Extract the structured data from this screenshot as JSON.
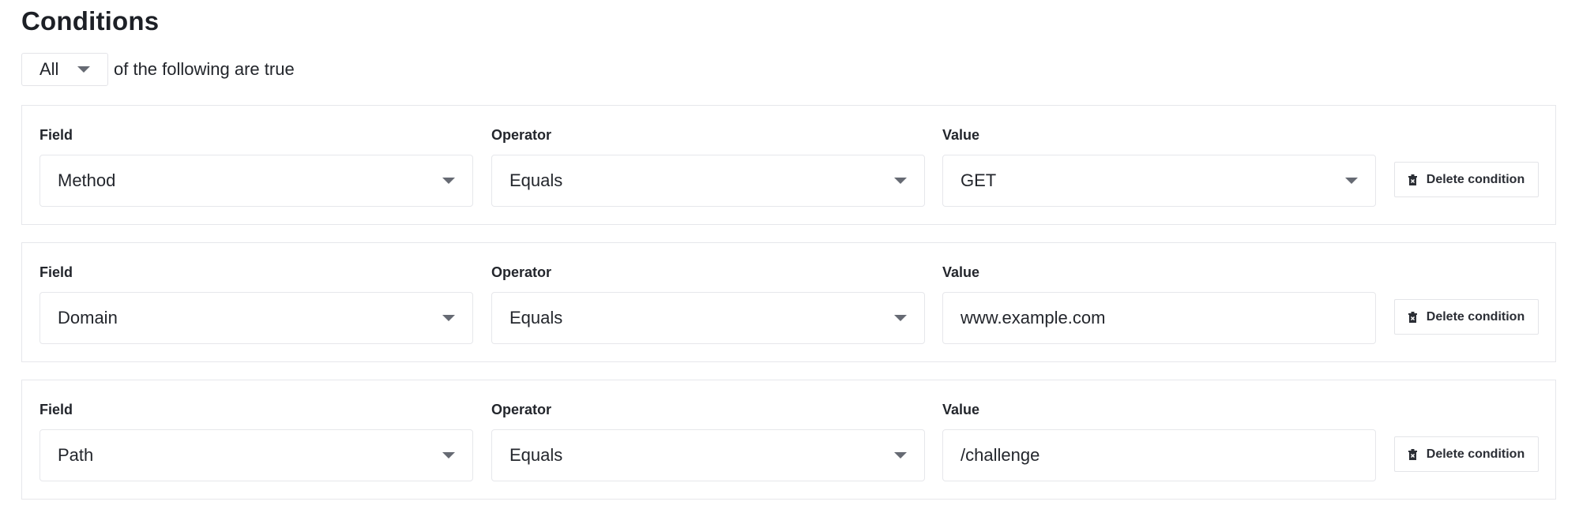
{
  "header": {
    "title": "Conditions"
  },
  "match": {
    "selected": "All",
    "suffix": "of the following are true"
  },
  "conditions": [
    {
      "field_label": "Field",
      "field_value": "Method",
      "operator_label": "Operator",
      "operator_value": "Equals",
      "value_label": "Value",
      "value_value": "GET",
      "value_type": "select",
      "delete_label": "Delete condition"
    },
    {
      "field_label": "Field",
      "field_value": "Domain",
      "operator_label": "Operator",
      "operator_value": "Equals",
      "value_label": "Value",
      "value_value": "www.example.com",
      "value_type": "text",
      "delete_label": "Delete condition"
    },
    {
      "field_label": "Field",
      "field_value": "Path",
      "operator_label": "Operator",
      "operator_value": "Equals",
      "value_label": "Value",
      "value_value": "/challenge",
      "value_type": "text",
      "delete_label": "Delete condition"
    }
  ],
  "icons": {
    "dropdown": "caret-down-icon",
    "delete": "trash-icon"
  },
  "colors": {
    "text": "#23262c",
    "border": "#e6e7eb",
    "caret": "#666a73"
  }
}
